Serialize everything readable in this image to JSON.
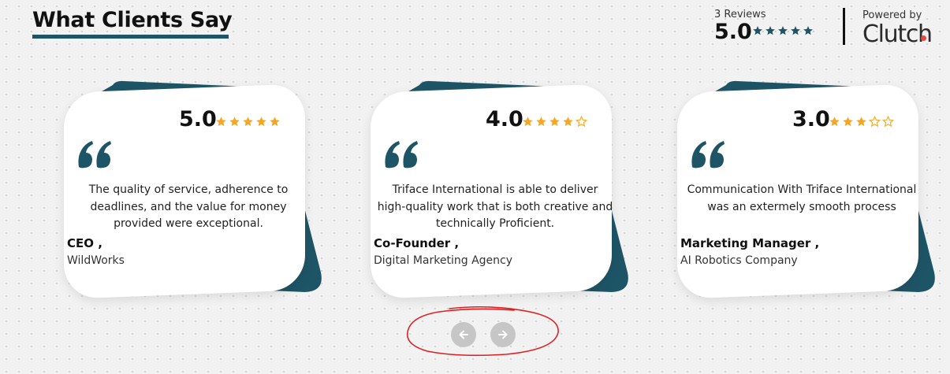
{
  "section": {
    "title": "What Clients Say"
  },
  "clutch": {
    "reviews_count": "3 Reviews",
    "score": "5.0",
    "stars_filled": 5,
    "powered_by": "Powered by",
    "logo_text": "Clutch",
    "star_color": "#1e5566"
  },
  "testimonials": [
    {
      "score": "5.0",
      "stars_filled": 5,
      "text": "The quality of service, adherence to deadlines, and the value for money provided were exceptional.",
      "role": "CEO ,",
      "company": "WildWorks"
    },
    {
      "score": "4.0",
      "stars_filled": 4,
      "text": "Triface International is able to deliver high-quality work that is both creative and technically Proficient.",
      "role": "Co-Founder ,",
      "company": "Digital Marketing Agency"
    },
    {
      "score": "3.0",
      "stars_filled": 3,
      "text": "Communication With Triface International was an extermely smooth process",
      "role": "Marketing Manager ,",
      "company": "AI Robotics Company"
    }
  ],
  "navigation": {
    "prev_icon": "arrow-left-icon",
    "next_icon": "arrow-right-icon"
  },
  "colors": {
    "accent": "#1e5566",
    "star": "#f5a623",
    "annotation": "#e02020"
  }
}
